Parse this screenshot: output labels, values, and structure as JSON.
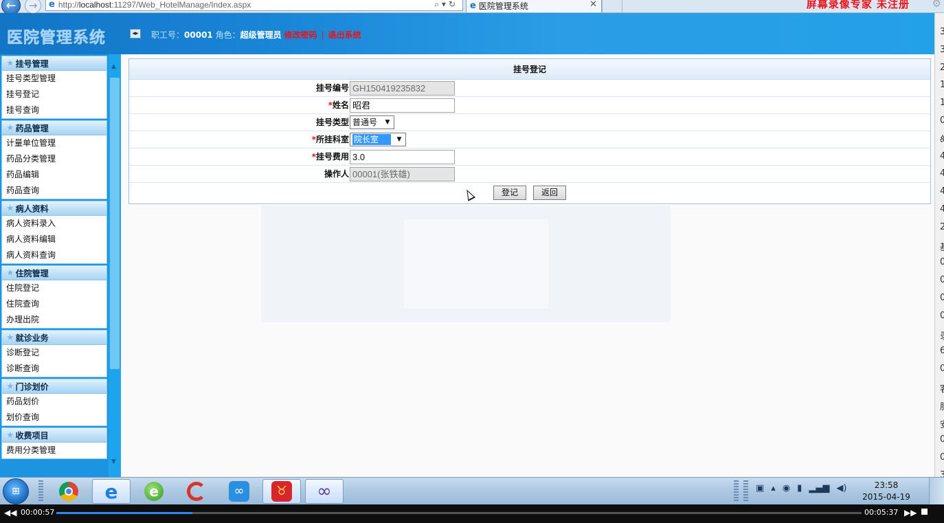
{
  "browser": {
    "url_prefix": "http://",
    "url_host": "localhost",
    "url_rest": ":11297/Web_HotelManage/Index.aspx",
    "tab_title": "医院管理系统",
    "watermark": "屏幕录像专家  未注册"
  },
  "header": {
    "logo": "医院管理系统",
    "staff_label": "职工号：",
    "staff_id": "00001",
    "role_label": "角色：",
    "role": "超级管理员",
    "change_password": "修改密码",
    "separator": "|",
    "logout": "退出系统"
  },
  "sidebar": {
    "groups": [
      {
        "title": "挂号管理",
        "items": [
          "挂号类型管理",
          "挂号登记",
          "挂号查询"
        ]
      },
      {
        "title": "药品管理",
        "items": [
          "计量单位管理",
          "药品分类管理",
          "药品编辑",
          "药品查询"
        ]
      },
      {
        "title": "病人资料",
        "items": [
          "病人资料录入",
          "病人资料编辑",
          "病人资料查询"
        ]
      },
      {
        "title": "住院管理",
        "items": [
          "住院登记",
          "住院查询",
          "办理出院"
        ]
      },
      {
        "title": "就诊业务",
        "items": [
          "诊断登记",
          "诊断查询"
        ]
      },
      {
        "title": "门诊划价",
        "items": [
          "药品划价",
          "划价查询"
        ]
      },
      {
        "title": "收费项目",
        "items": [
          "费用分类管理"
        ]
      }
    ]
  },
  "form": {
    "title": "挂号登记",
    "required_mark": "*",
    "fields": {
      "reg_no": {
        "label": "挂号编号",
        "value": "GH150419235832"
      },
      "name": {
        "label": "姓名",
        "value": "昭君"
      },
      "reg_type": {
        "label": "挂号类型",
        "value": "普通号"
      },
      "department": {
        "label": "所挂科室",
        "value": "院长室"
      },
      "fee": {
        "label": "挂号费用",
        "value": "3.0"
      },
      "operator": {
        "label": "操作人",
        "value": "00001(张铁雄)"
      }
    },
    "submit_label": "登记",
    "back_label": "返回"
  },
  "right_strip": [
    "3",
    "3",
    "2",
    "1",
    "1",
    "0",
    "ዿ",
    "4",
    "4",
    "4",
    "4",
    "2",
    "基",
    "0",
    "0",
    "0",
    "0",
    "录",
    "6",
    "0",
    "客",
    "服",
    "安",
    "0",
    "0",
    "3"
  ],
  "taskbar": {
    "time": "23:58",
    "date": "2015-04-19"
  },
  "player": {
    "current_time": "00:00:57",
    "total_time": "00:05:37",
    "progress": 0.169
  },
  "colors": {
    "header_blue": "#1a86d6",
    "sidebar_blue": "#1a96e0",
    "link_red": "#e8141b"
  }
}
